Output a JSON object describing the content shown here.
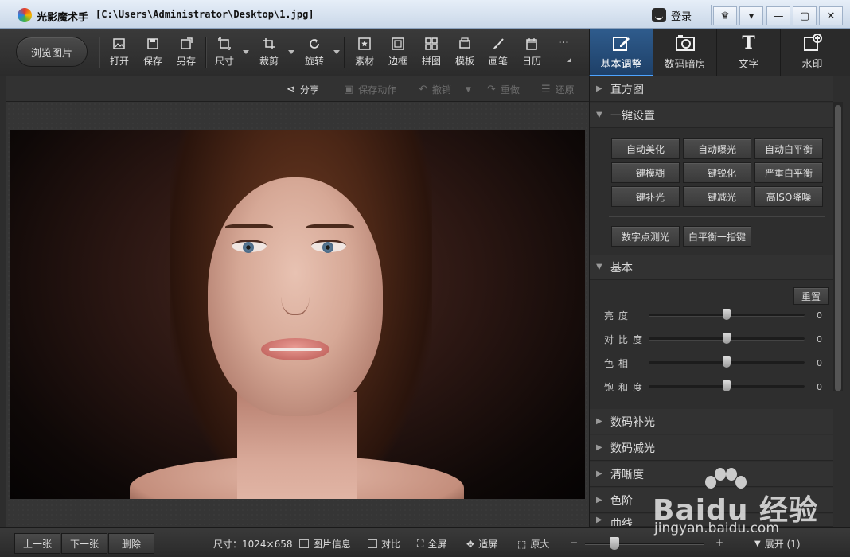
{
  "titlebar": {
    "app_title": "光影魔术手",
    "file_path": "[C:\\Users\\Administrator\\Desktop\\1.jpg]",
    "login_label": "登录"
  },
  "toolbar": {
    "browse_label": "浏览图片",
    "tools": [
      {
        "label": "打开",
        "icon": "open-image-icon"
      },
      {
        "label": "保存",
        "icon": "save-icon"
      },
      {
        "label": "另存",
        "icon": "save-as-icon"
      },
      {
        "label": "尺寸",
        "icon": "resize-icon"
      },
      {
        "label": "裁剪",
        "icon": "crop-icon"
      },
      {
        "label": "旋转",
        "icon": "rotate-icon"
      },
      {
        "label": "素材",
        "icon": "material-icon"
      },
      {
        "label": "边框",
        "icon": "border-icon"
      },
      {
        "label": "拼图",
        "icon": "collage-icon"
      },
      {
        "label": "模板",
        "icon": "template-icon"
      },
      {
        "label": "画笔",
        "icon": "brush-icon"
      },
      {
        "label": "日历",
        "icon": "calendar-icon"
      },
      {
        "label": "···",
        "icon": "more-icon"
      }
    ]
  },
  "right_tabs": [
    {
      "label": "基本调整",
      "active": true
    },
    {
      "label": "数码暗房",
      "active": false
    },
    {
      "label": "文字",
      "active": false
    },
    {
      "label": "水印",
      "active": false
    }
  ],
  "subbar": {
    "share": "分享",
    "save_action": "保存动作",
    "undo": "撤销",
    "redo": "重做",
    "restore": "还原"
  },
  "panel": {
    "histogram": "直方图",
    "one_click": "一键设置",
    "one_click_buttons": [
      "自动美化",
      "自动曝光",
      "自动白平衡",
      "一键模糊",
      "一键锐化",
      "严重白平衡",
      "一键补光",
      "一键减光",
      "高ISO降噪"
    ],
    "extra_buttons": [
      "数字点测光",
      "白平衡一指键"
    ],
    "basic": "基本",
    "reset": "重置",
    "sliders": [
      {
        "label": "亮度",
        "value": "0",
        "level": 0.5
      },
      {
        "label": "对比度",
        "value": "0",
        "level": 0.5
      },
      {
        "label": "色相",
        "value": "0",
        "level": 0.5
      },
      {
        "label": "饱和度",
        "value": "0",
        "level": 0.5
      }
    ],
    "sections": [
      "数码补光",
      "数码减光",
      "清晰度",
      "色阶",
      "曲线"
    ]
  },
  "bottom": {
    "prev": "上一张",
    "next": "下一张",
    "delete": "删除",
    "size": "尺寸：1024×658",
    "info": "图片信息",
    "compare": "对比",
    "fullscreen": "全屏",
    "fit": "适屏",
    "original": "原大",
    "zoom_minus": "−",
    "zoom_plus": "+",
    "expand": "展开 (1)"
  },
  "watermark": {
    "brand": "Baidu 经验",
    "url": "jingyan.baidu.com"
  },
  "colors": {
    "accent": "#2f5c8d",
    "panel_bg": "#2e2e2e",
    "titlebar": "#d6e2ef"
  }
}
